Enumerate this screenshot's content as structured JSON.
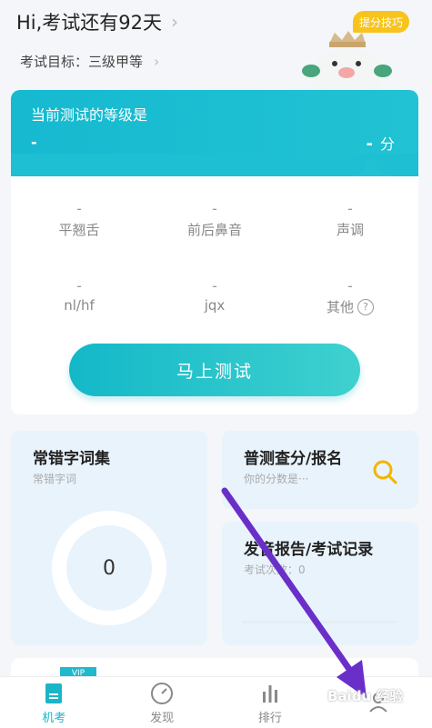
{
  "header": {
    "title": "Hi,考试还有92天",
    "goal": "考试目标：三级甲等",
    "tip_badge": "提分技巧"
  },
  "level": {
    "label": "当前测试的等级是",
    "grade": "-",
    "score_value": "-",
    "score_unit": "分",
    "metrics": [
      {
        "value": "-",
        "name": "平翘舌"
      },
      {
        "value": "-",
        "name": "前后鼻音"
      },
      {
        "value": "-",
        "name": "声调"
      },
      {
        "value": "-",
        "name": "nl/hf"
      },
      {
        "value": "-",
        "name": "jqx"
      },
      {
        "value": "-",
        "name": "其他"
      }
    ],
    "help_icon": "?",
    "test_button": "马上测试"
  },
  "errors_card": {
    "title": "常错字词集",
    "subtitle": "常错字词",
    "count": "0"
  },
  "score_card": {
    "title": "普测查分/报名",
    "subtitle": "你的分数是···"
  },
  "report_card": {
    "title": "发音报告/考试记录",
    "subtitle": "考试次数：0"
  },
  "vip": {
    "tag": "VIP"
  },
  "tabs": [
    {
      "label": "机考",
      "icon": "document-icon"
    },
    {
      "label": "发现",
      "icon": "compass-icon"
    },
    {
      "label": "排行",
      "icon": "bar-chart-icon"
    },
    {
      "label": "",
      "icon": "user-icon"
    }
  ],
  "watermark": "Baidu 经验",
  "colors": {
    "accent": "#1bb5c8",
    "badge": "#f7c41d",
    "arrow": "#6a2fc9"
  }
}
